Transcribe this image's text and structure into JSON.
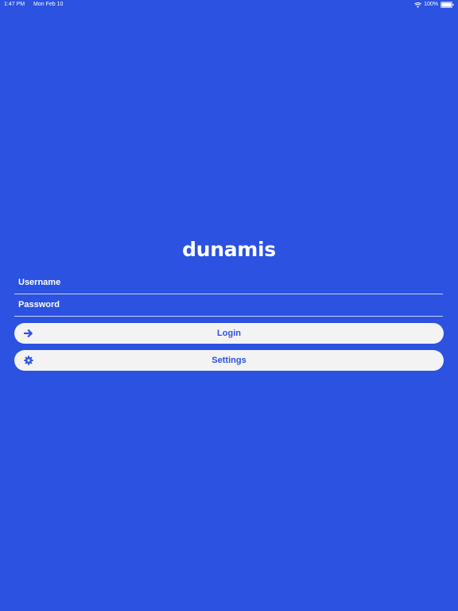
{
  "status_bar": {
    "time": "1:47 PM",
    "date": "Mon Feb 10",
    "battery": "100%",
    "icons": [
      "wifi-icon",
      "battery-icon"
    ]
  },
  "logo": {
    "text": "dunamis"
  },
  "form": {
    "username_placeholder": "Username",
    "username_value": "",
    "password_placeholder": "Password",
    "password_value": ""
  },
  "buttons": {
    "login_label": "Login",
    "login_icon": "arrow-right-icon",
    "settings_label": "Settings",
    "settings_icon": "gear-icon"
  },
  "colors": {
    "background": "#2b52e0",
    "button_background": "#f3f3f4",
    "button_text": "#2b52e0",
    "text": "#ffffff"
  }
}
